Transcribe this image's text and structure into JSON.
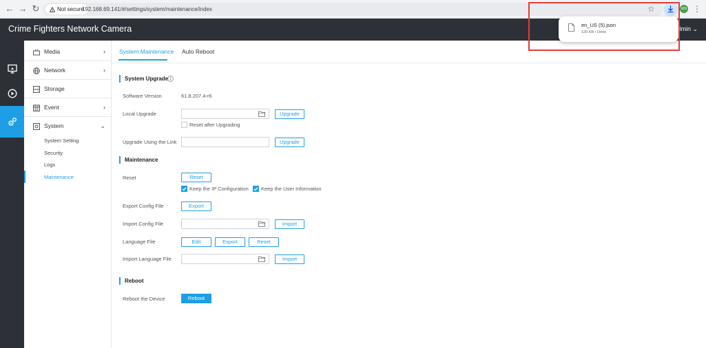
{
  "browser": {
    "back_icon": "arrow-left",
    "forward_icon": "arrow-right",
    "reload_icon": "reload",
    "security_label": "Not secure",
    "url": "192.168.69.141/#/settings/system/maintenance/index",
    "profile_initials": "WS",
    "download": {
      "file_name": "en_US (5).json",
      "meta": "120 KB • Done"
    }
  },
  "app": {
    "title": "Crime Fighters Network Camera",
    "user_label": "admin"
  },
  "rail": {
    "items": [
      {
        "icon": "live-view-icon"
      },
      {
        "icon": "playback-icon"
      },
      {
        "icon": "settings-icon",
        "active": true
      }
    ]
  },
  "sidebar": {
    "groups": [
      {
        "label": "Media",
        "caret": "›"
      },
      {
        "label": "Network",
        "caret": "›"
      },
      {
        "label": "Storage",
        "caret": ""
      },
      {
        "label": "Event",
        "caret": "›"
      },
      {
        "label": "System",
        "caret": "⌄"
      }
    ],
    "system_items": [
      {
        "label": "System Setting"
      },
      {
        "label": "Security"
      },
      {
        "label": "Logs"
      },
      {
        "label": "Maintenance",
        "active": true
      }
    ]
  },
  "tabs": [
    {
      "label": "System Maintenance",
      "active": true
    },
    {
      "label": "Auto Reboot"
    }
  ],
  "upgrade": {
    "title": "System Upgrade",
    "software_version_label": "Software Version",
    "software_version": "61.8.207.4-r6",
    "local_upgrade_label": "Local Upgrade",
    "upgrade_button": "Upgrade",
    "reset_after_label": "Reset after Upgrading",
    "link_label": "Upgrade Using the Link",
    "link_upgrade_button": "Upgrade"
  },
  "maintenance": {
    "title": "Maintenance",
    "reset_label": "Reset",
    "reset_button": "Reset",
    "keep_ip_label": "Keep the IP Configuration",
    "keep_user_label": "Keep the User Information",
    "export_config_label": "Export Config File",
    "export_button": "Export",
    "import_config_label": "Import Config File",
    "import_button": "Import",
    "language_label": "Language File",
    "edit_button": "Edit",
    "language_export_button": "Export",
    "language_reset_button": "Reset",
    "import_language_label": "Import Language File",
    "import_language_button": "Import"
  },
  "reboot": {
    "title": "Reboot",
    "device_label": "Reboot the Device",
    "reboot_button": "Reboot"
  },
  "colors": {
    "accent": "#1e9fe5",
    "header": "#2d3137",
    "highlight": "#e53935"
  }
}
